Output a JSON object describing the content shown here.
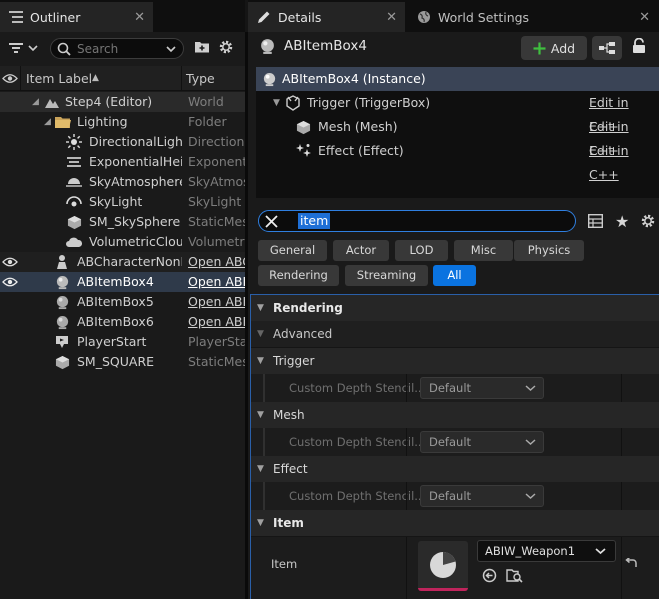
{
  "outliner": {
    "tab_label": "Outliner",
    "search_placeholder": "Search",
    "columns": {
      "label": "Item Label",
      "sort_arrow": "▲",
      "type": "Type"
    },
    "rows": [
      {
        "label": "Step4 (Editor)",
        "type": "World",
        "icon": "level-icon"
      },
      {
        "label": "Lighting",
        "type": "Folder",
        "icon": "folder-icon"
      },
      {
        "label": "DirectionalLight",
        "type": "Directional",
        "icon": "sun-icon"
      },
      {
        "label": "ExponentialHeightFog",
        "type": "ExponentialHeightFog",
        "icon": "fog-icon"
      },
      {
        "label": "SkyAtmosphere",
        "type": "SkyAtmosphere",
        "icon": "sky-atmosphere-icon"
      },
      {
        "label": "SkyLight",
        "type": "SkyLight",
        "icon": "skylight-icon"
      },
      {
        "label": "SM_SkySphere",
        "type": "StaticMeshActor",
        "icon": "mesh-icon"
      },
      {
        "label": "VolumetricCloud",
        "type": "VolumetricCloud",
        "icon": "cloud-icon"
      },
      {
        "label": "ABCharacterNonPlayer",
        "type": "Open ABCharacterNonPlayer",
        "icon": "pawn-icon"
      },
      {
        "label": "ABItemBox4",
        "type": "Open ABItemBox",
        "icon": "actor-icon"
      },
      {
        "label": "ABItemBox5",
        "type": "Open ABItemBox",
        "icon": "actor-icon"
      },
      {
        "label": "ABItemBox6",
        "type": "Open ABItemBox",
        "icon": "actor-icon"
      },
      {
        "label": "PlayerStart",
        "type": "PlayerStart",
        "icon": "player-start-icon"
      },
      {
        "label": "SM_SQUARE",
        "type": "StaticMeshActor",
        "icon": "mesh-icon"
      }
    ]
  },
  "details": {
    "tab_label": "Details",
    "world_settings_tab": "World Settings",
    "actor_name": "ABItemBox4",
    "add_label": "Add",
    "components": [
      {
        "label": "ABItemBox4 (Instance)",
        "edit": ""
      },
      {
        "label": "Trigger (TriggerBox)",
        "edit": "Edit in C++"
      },
      {
        "label": "Mesh (Mesh)",
        "edit": "Edit in C++"
      },
      {
        "label": "Effect (Effect)",
        "edit": "Edit in C++"
      }
    ],
    "search_value": "item",
    "filters_row1": [
      "General",
      "Actor",
      "LOD",
      "Misc",
      "Physics"
    ],
    "filters_row2": [
      "Rendering",
      "Streaming",
      "All"
    ],
    "active_filter": "All",
    "categories": {
      "rendering": "Rendering",
      "advanced": "Advanced",
      "trigger": "Trigger",
      "mesh": "Mesh",
      "effect": "Effect",
      "item": "Item"
    },
    "property_label": "Custom Depth Stencil...",
    "default_value": "Default",
    "item_label": "Item",
    "item_asset": "ABIW_Weapon1"
  },
  "colors": {
    "accent_blue": "#0a73e0",
    "add_green": "#3fbf3f",
    "thumbnail_underline": "#c0245c"
  }
}
